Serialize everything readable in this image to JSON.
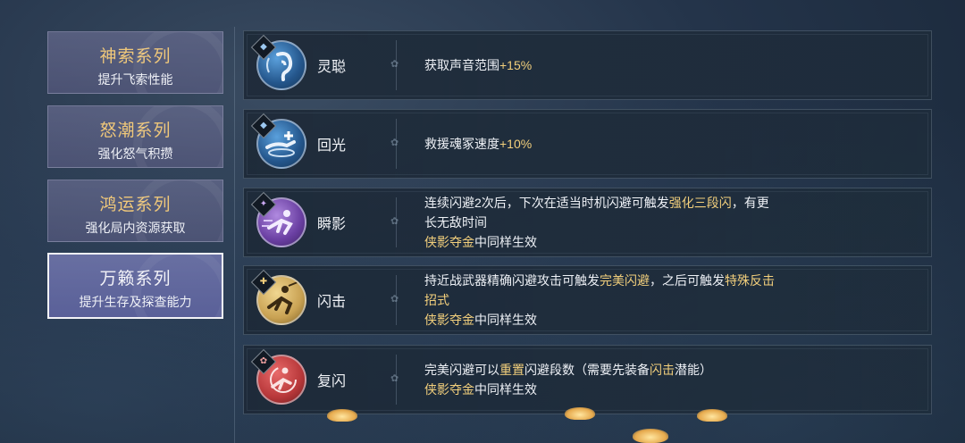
{
  "categories": [
    {
      "title": "神索系列",
      "subtitle": "提升飞索性能",
      "active": false
    },
    {
      "title": "怒潮系列",
      "subtitle": "强化怒气积攒",
      "active": false
    },
    {
      "title": "鸿运系列",
      "subtitle": "强化局内资源获取",
      "active": false
    },
    {
      "title": "万籁系列",
      "subtitle": "提升生存及探查能力",
      "active": true
    }
  ],
  "skills": [
    {
      "name": "灵聪",
      "icon": "ear-icon",
      "desc_line1": "获取声音范围",
      "desc_hl1": "+15%"
    },
    {
      "name": "回光",
      "icon": "rescue-hand-icon",
      "desc_line1": "救援魂冢速度",
      "desc_hl1": "+10%"
    },
    {
      "name": "瞬影",
      "icon": "dash-figure-icon",
      "desc_a": "连续闪避2次后，下次在适当时机闪避可触发",
      "desc_hl": "强化三段闪",
      "desc_b": "，有更",
      "desc_c": "长无敌时间",
      "shared_hl": "侠影夺金",
      "shared_rest": "中同样生效"
    },
    {
      "name": "闪击",
      "icon": "counter-strike-icon",
      "desc_a": "持近战武器精确闪避攻击可触发",
      "desc_hl": "完美闪避",
      "desc_b": "，之后可触发",
      "desc_hl2": "特殊反击",
      "desc_c": "招式",
      "shared_hl": "侠影夺金",
      "shared_rest": "中同样生效"
    },
    {
      "name": "复闪",
      "icon": "reset-dodge-icon",
      "desc_a": "完美闪避可以",
      "desc_hl": "重置",
      "desc_b": "闪避段数（需要先装备",
      "desc_hl2": "闪击",
      "desc_c": "潜能）",
      "shared_hl": "侠影夺金",
      "shared_rest": "中同样生效"
    }
  ],
  "colors": {
    "accent_gold": "#f2cf7c",
    "rarity_blue": "#2f6ea8",
    "rarity_purple": "#7a4fb0",
    "rarity_gold": "#c9a253",
    "rarity_red": "#b8383a"
  }
}
